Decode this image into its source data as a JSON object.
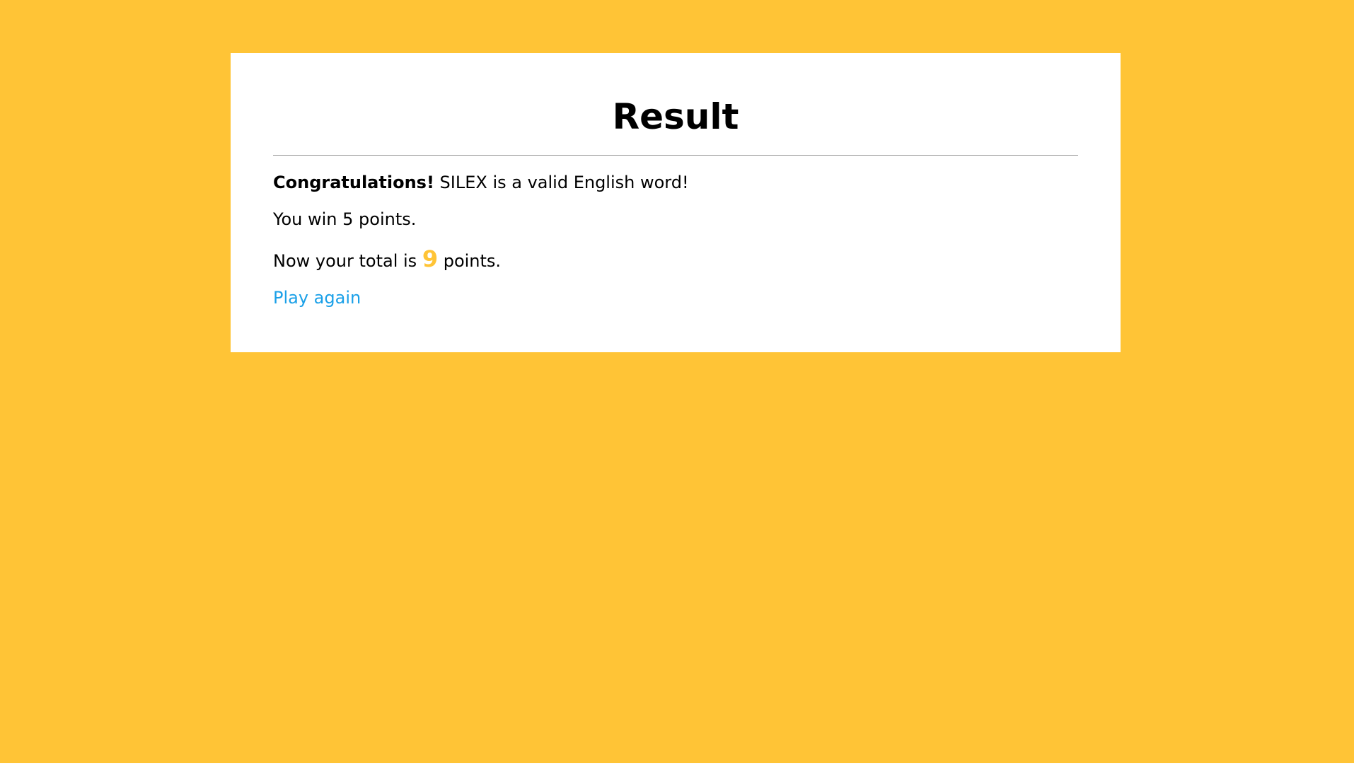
{
  "colors": {
    "background": "#ffc436",
    "card": "#ffffff",
    "accent": "#ffc436",
    "link": "#1aa0e8",
    "divider": "#9a9a9a"
  },
  "result": {
    "title": "Result",
    "congrats_label": "Congratulations!",
    "word_sentence": "SILEX is a valid English word!",
    "win_sentence": "You win 5 points.",
    "total_prefix": "Now your total is",
    "total_value": "9",
    "total_suffix": "points.",
    "play_again_label": "Play again"
  }
}
